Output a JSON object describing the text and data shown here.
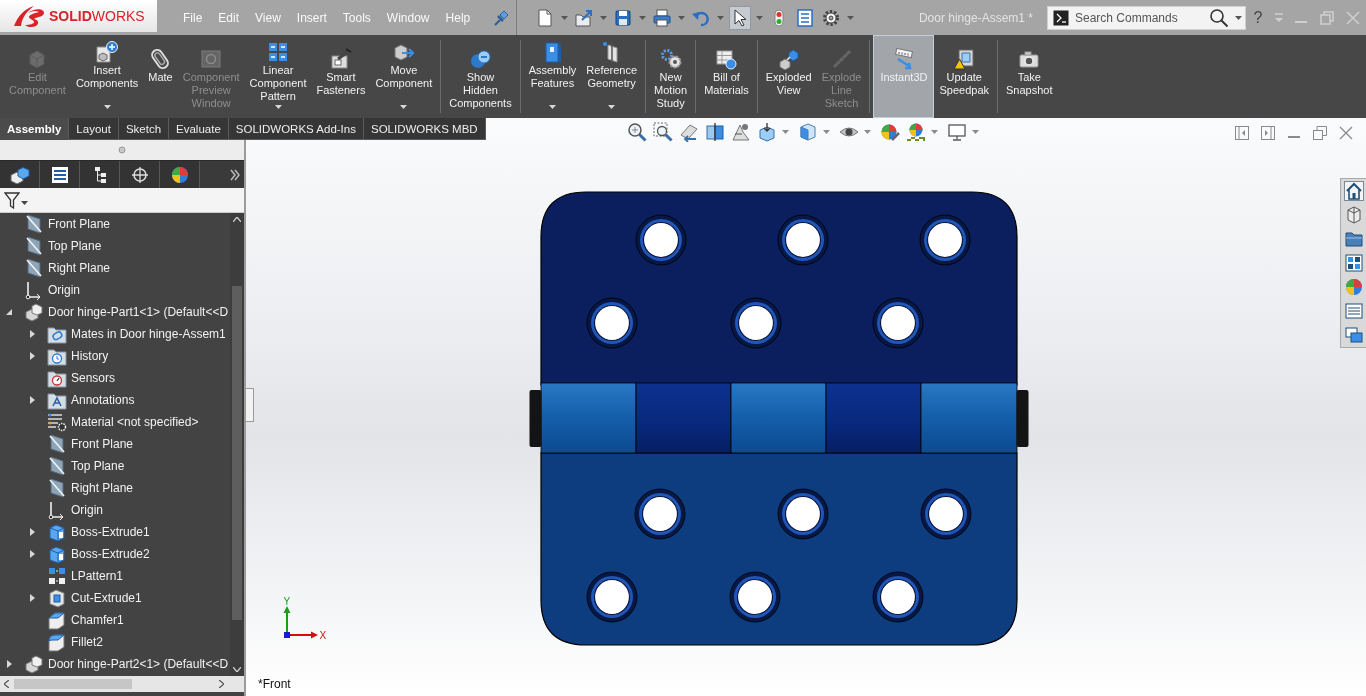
{
  "app": {
    "logo": "**SOLID**WORKS"
  },
  "menu": [
    "File",
    "Edit",
    "View",
    "Insert",
    "Tools",
    "Window",
    "Help"
  ],
  "quick_access": [
    {
      "dropdown": true,
      "on": false
    },
    {
      "dropdown": true,
      "on": false
    },
    {
      "dropdown": true,
      "on": false
    },
    {
      "dropdown": true,
      "on": false
    },
    {
      "dropdown": true,
      "on": false
    },
    {
      "dropdown": true,
      "on": true
    },
    {
      "on": false
    },
    {
      "on": false
    },
    {
      "dropdown": true,
      "on": false
    }
  ],
  "document_title": "Door hinge-Assem1 *",
  "search": {
    "placeholder": "Search Commands"
  },
  "window_controls": {
    "help": "?"
  },
  "ribbon": {
    "groups": [
      {
        "buttons": [
          {
            "label_lines": [
              "Edit",
              "Component"
            ],
            "disabled": true,
            "dropdown": false,
            "on": false
          },
          {
            "label_lines": [
              "Insert",
              "Components"
            ],
            "disabled": false,
            "dropdown": true,
            "on": false
          },
          {
            "label_lines": [
              "Mate"
            ],
            "disabled": false,
            "dropdown": false,
            "on": false
          },
          {
            "label_lines": [
              "Component",
              "Preview",
              "Window"
            ],
            "disabled": true,
            "dropdown": false,
            "on": false
          },
          {
            "label_lines": [
              "Linear",
              "Component",
              "Pattern"
            ],
            "disabled": false,
            "dropdown": true,
            "on": false
          },
          {
            "label_lines": [
              "Smart",
              "Fasteners"
            ],
            "disabled": false,
            "dropdown": false,
            "on": false
          },
          {
            "label_lines": [
              "Move",
              "Component"
            ],
            "disabled": false,
            "dropdown": true,
            "on": false
          }
        ]
      },
      {
        "buttons": [
          {
            "label_lines": [
              "Show",
              "Hidden",
              "Components"
            ],
            "disabled": false,
            "dropdown": false,
            "on": false
          }
        ]
      },
      {
        "buttons": [
          {
            "label_lines": [
              "Assembly",
              "Features"
            ],
            "disabled": false,
            "dropdown": true,
            "on": false
          },
          {
            "label_lines": [
              "Reference",
              "Geometry"
            ],
            "disabled": false,
            "dropdown": true,
            "on": false
          }
        ]
      },
      {
        "buttons": [
          {
            "label_lines": [
              "New",
              "Motion",
              "Study"
            ],
            "disabled": false,
            "dropdown": false,
            "on": false
          }
        ]
      },
      {
        "buttons": [
          {
            "label_lines": [
              "Bill of",
              "Materials"
            ],
            "disabled": false,
            "dropdown": false,
            "on": false
          }
        ]
      },
      {
        "buttons": [
          {
            "label_lines": [
              "Exploded",
              "View"
            ],
            "disabled": false,
            "dropdown": false,
            "on": false
          },
          {
            "label_lines": [
              "Explode",
              "Line",
              "Sketch"
            ],
            "disabled": true,
            "dropdown": false,
            "on": false
          }
        ]
      },
      {
        "buttons": [
          {
            "label_lines": [
              "Instant3D"
            ],
            "disabled": false,
            "dropdown": false,
            "on": true
          },
          {
            "label_lines": [
              "Update",
              "Speedpak"
            ],
            "disabled": false,
            "dropdown": false,
            "on": false
          }
        ]
      },
      {
        "buttons": [
          {
            "label_lines": [
              "Take",
              "Snapshot"
            ],
            "disabled": false,
            "dropdown": false,
            "on": false
          }
        ]
      }
    ]
  },
  "tabs": [
    {
      "label": "Assembly",
      "selected": true
    },
    {
      "label": "Layout",
      "selected": false
    },
    {
      "label": "Sketch",
      "selected": false
    },
    {
      "label": "Evaluate",
      "selected": false
    },
    {
      "label": "SOLIDWORKS Add-Ins",
      "selected": false
    },
    {
      "label": "SOLIDWORKS MBD",
      "selected": false
    }
  ],
  "feature_tree": {
    "items": [
      {
        "label": "Front Plane",
        "kind": "plane"
      },
      {
        "label": "Top Plane",
        "kind": "plane"
      },
      {
        "label": "Right Plane",
        "kind": "plane"
      },
      {
        "label": "Origin",
        "kind": "origin"
      },
      {
        "label": "Door hinge-Part1<1> (Default<<D",
        "kind": "part",
        "expanded": true,
        "children": [
          {
            "label": "Mates in Door hinge-Assem1",
            "kind": "mates",
            "expanded": false
          },
          {
            "label": "History",
            "kind": "history",
            "expanded": false
          },
          {
            "label": "Sensors",
            "kind": "sensors"
          },
          {
            "label": "Annotations",
            "kind": "annotations",
            "expanded": false
          },
          {
            "label": "Material <not specified>",
            "kind": "material"
          },
          {
            "label": "Front Plane",
            "kind": "plane"
          },
          {
            "label": "Top Plane",
            "kind": "plane"
          },
          {
            "label": "Right Plane",
            "kind": "plane"
          },
          {
            "label": "Origin",
            "kind": "origin"
          },
          {
            "label": "Boss-Extrude1",
            "kind": "extrude",
            "expanded": false
          },
          {
            "label": "Boss-Extrude2",
            "kind": "extrude",
            "expanded": false
          },
          {
            "label": "LPattern1",
            "kind": "pattern"
          },
          {
            "label": "Cut-Extrude1",
            "kind": "cut",
            "expanded": false
          },
          {
            "label": "Chamfer1",
            "kind": "chamfer"
          },
          {
            "label": "Fillet2",
            "kind": "fillet"
          }
        ]
      },
      {
        "label": "Door hinge-Part2<1> (Default<<D",
        "kind": "part",
        "expanded": false
      }
    ]
  },
  "viewport": {
    "view_name": "*Front",
    "triad": {
      "x_label": "X",
      "y_label": "Y"
    }
  }
}
